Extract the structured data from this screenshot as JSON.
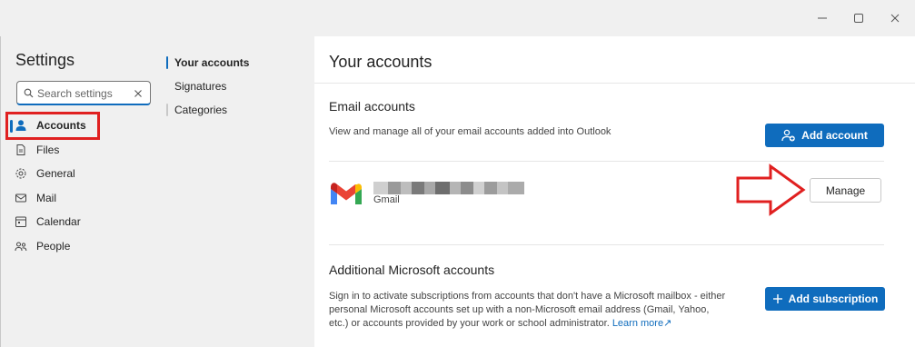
{
  "window": {
    "controls": [
      "minimize-icon",
      "maximize-icon",
      "close-icon"
    ]
  },
  "left_nav": {
    "title": "Settings",
    "search_placeholder": "Search settings",
    "items": [
      {
        "label": "Accounts",
        "icon": "person-icon",
        "active": true
      },
      {
        "label": "Files",
        "icon": "file-icon",
        "active": false
      },
      {
        "label": "General",
        "icon": "gear-icon",
        "active": false
      },
      {
        "label": "Mail",
        "icon": "mail-icon",
        "active": false
      },
      {
        "label": "Calendar",
        "icon": "calendar-icon",
        "active": false
      },
      {
        "label": "People",
        "icon": "people-icon",
        "active": false
      }
    ]
  },
  "sub_nav": {
    "items": [
      {
        "label": "Your accounts",
        "active": true
      },
      {
        "label": "Signatures",
        "active": false
      },
      {
        "label": "Categories",
        "active": false
      }
    ]
  },
  "main": {
    "title": "Your accounts",
    "email_accounts": {
      "heading": "Email accounts",
      "description": "View and manage all of your email accounts added into Outlook",
      "add_button": "Add account",
      "account": {
        "type": "Gmail",
        "manage_button": "Manage"
      }
    },
    "additional": {
      "heading": "Additional Microsoft accounts",
      "description": "Sign in to activate subscriptions from accounts that don't have a Microsoft mailbox - either personal Microsoft accounts set up with a non-Microsoft email address (Gmail, Yahoo, etc.) or accounts provided by your work or school administrator.",
      "learn_more": "Learn more",
      "add_button": "Add subscription"
    }
  },
  "colors": {
    "accent": "#0f6cbd",
    "annotation_red": "#e02020"
  }
}
